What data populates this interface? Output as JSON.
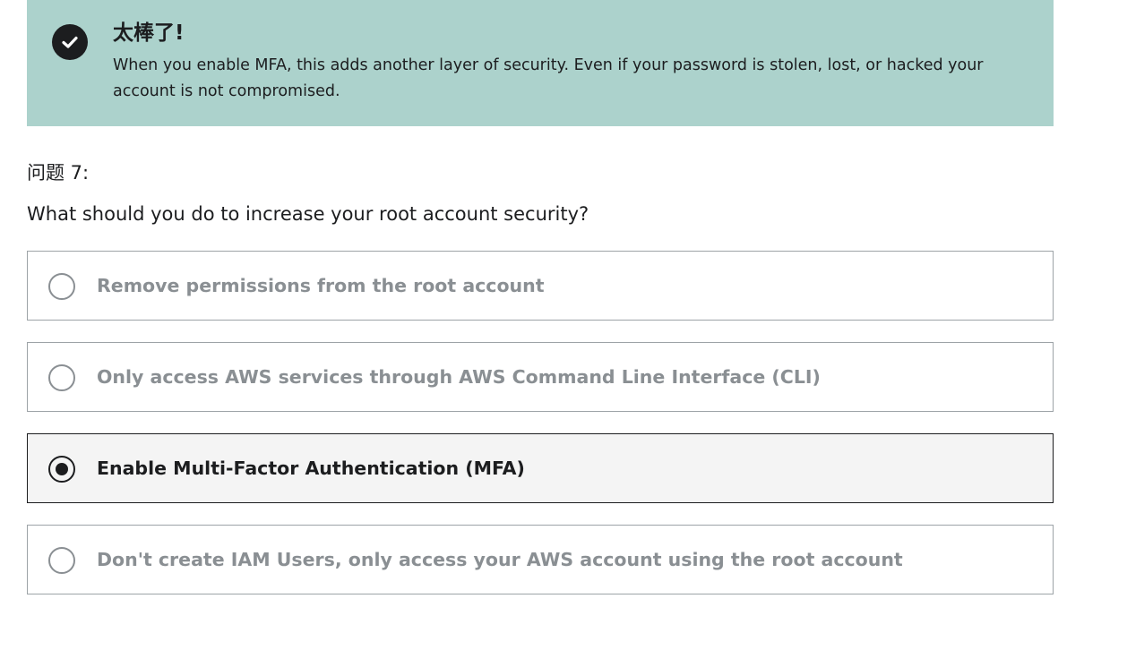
{
  "feedback": {
    "icon": "checkmark-circle-icon",
    "title": "太棒了!",
    "message": "When you enable MFA, this adds another layer of security. Even if your password is stolen, lost, or hacked your account is not compromised.",
    "background_color": "#acd2cc"
  },
  "question": {
    "number_label": "问题 7:",
    "text": "What should you do to increase your root account security?"
  },
  "options": [
    {
      "label": "Remove permissions from the root account",
      "selected": false
    },
    {
      "label": "Only access AWS services through AWS Command Line Interface (CLI)",
      "selected": false
    },
    {
      "label": "Enable Multi-Factor Authentication (MFA)",
      "selected": true
    },
    {
      "label": "Don't create IAM Users, only access your AWS account using the root account",
      "selected": false
    }
  ]
}
